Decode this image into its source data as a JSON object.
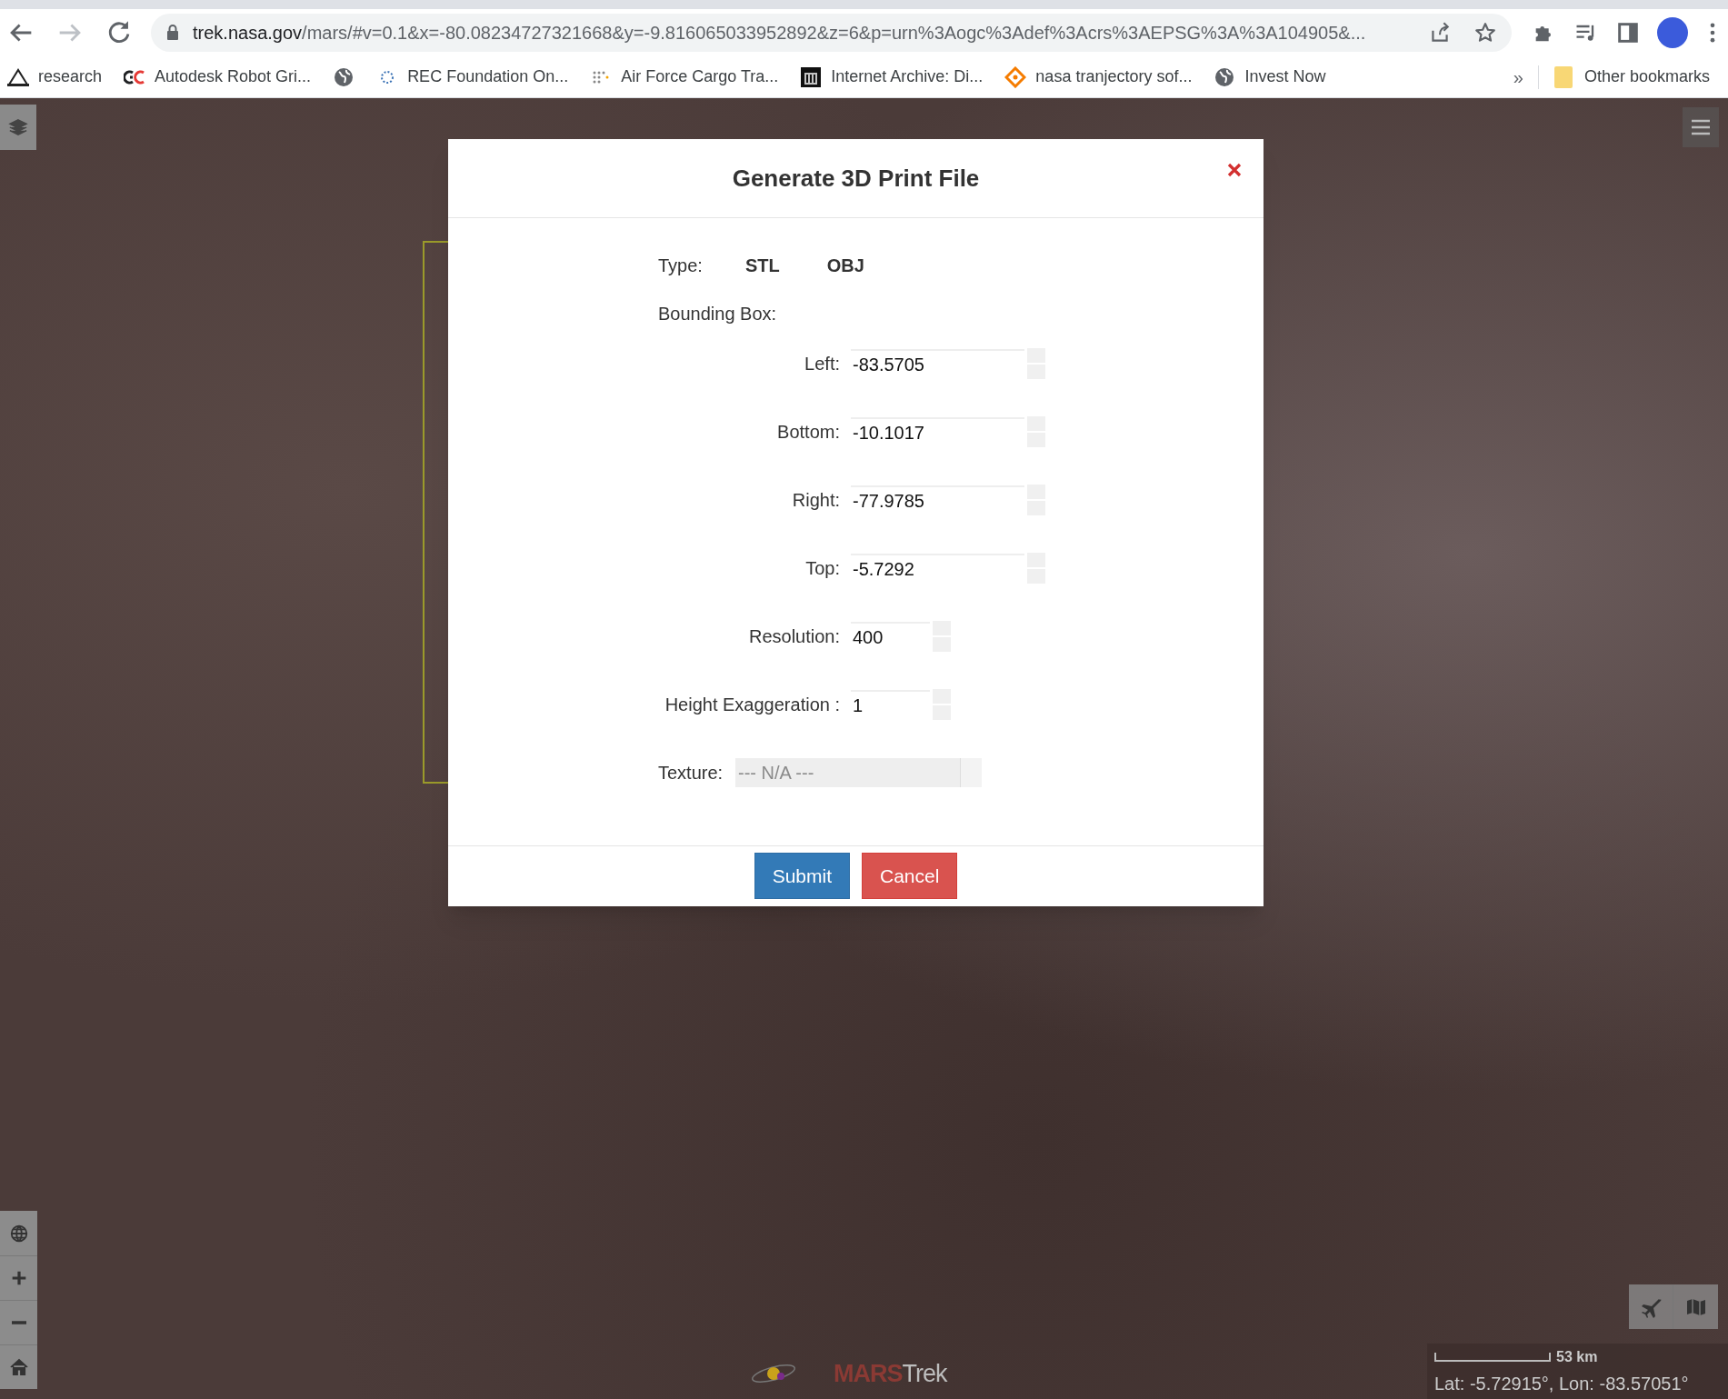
{
  "browser": {
    "url_host": "trek.nasa.gov",
    "url_rest": "/mars/#v=0.1&x=-80.08234727321668&y=-9.816065033952892&z=6&p=urn%3Aogc%3Adef%3Acrs%3AEPSG%3A%3A104905&...",
    "bookmarks": [
      {
        "label": "research"
      },
      {
        "label": "Autodesk Robot Gri..."
      },
      {
        "label": "REC Foundation On..."
      },
      {
        "label": "Air Force Cargo Tra..."
      },
      {
        "label": "Internet Archive: Di..."
      },
      {
        "label": "nasa tranjectory sof..."
      },
      {
        "label": "Invest Now"
      }
    ],
    "more": "»",
    "other_bookmarks": "Other bookmarks"
  },
  "dialog": {
    "title": "Generate 3D Print File",
    "type_label": "Type:",
    "types": [
      "STL",
      "OBJ"
    ],
    "bounding_label": "Bounding Box:",
    "fields": [
      {
        "label": "Left:",
        "value": "-83.5705",
        "kind": "long"
      },
      {
        "label": "Bottom:",
        "value": "-10.1017",
        "kind": "long"
      },
      {
        "label": "Right:",
        "value": "-77.9785",
        "kind": "long"
      },
      {
        "label": "Top:",
        "value": "-5.7292",
        "kind": "long"
      },
      {
        "label": "Resolution:",
        "value": "400",
        "kind": "short"
      },
      {
        "label": "Height Exaggeration :",
        "value": "1",
        "kind": "short"
      }
    ],
    "texture": {
      "label": "Texture:",
      "value": "--- N/A ---",
      "disabled": true
    },
    "buttons": [
      {
        "label": "Submit",
        "kind": "primary"
      },
      {
        "label": "Cancel",
        "kind": "danger"
      }
    ]
  },
  "map": {
    "logo_a": "MARS",
    "logo_b": "Trek",
    "scale": "53 km",
    "coordinates": "Lat: -5.72915°, Lon: -83.57051°"
  }
}
